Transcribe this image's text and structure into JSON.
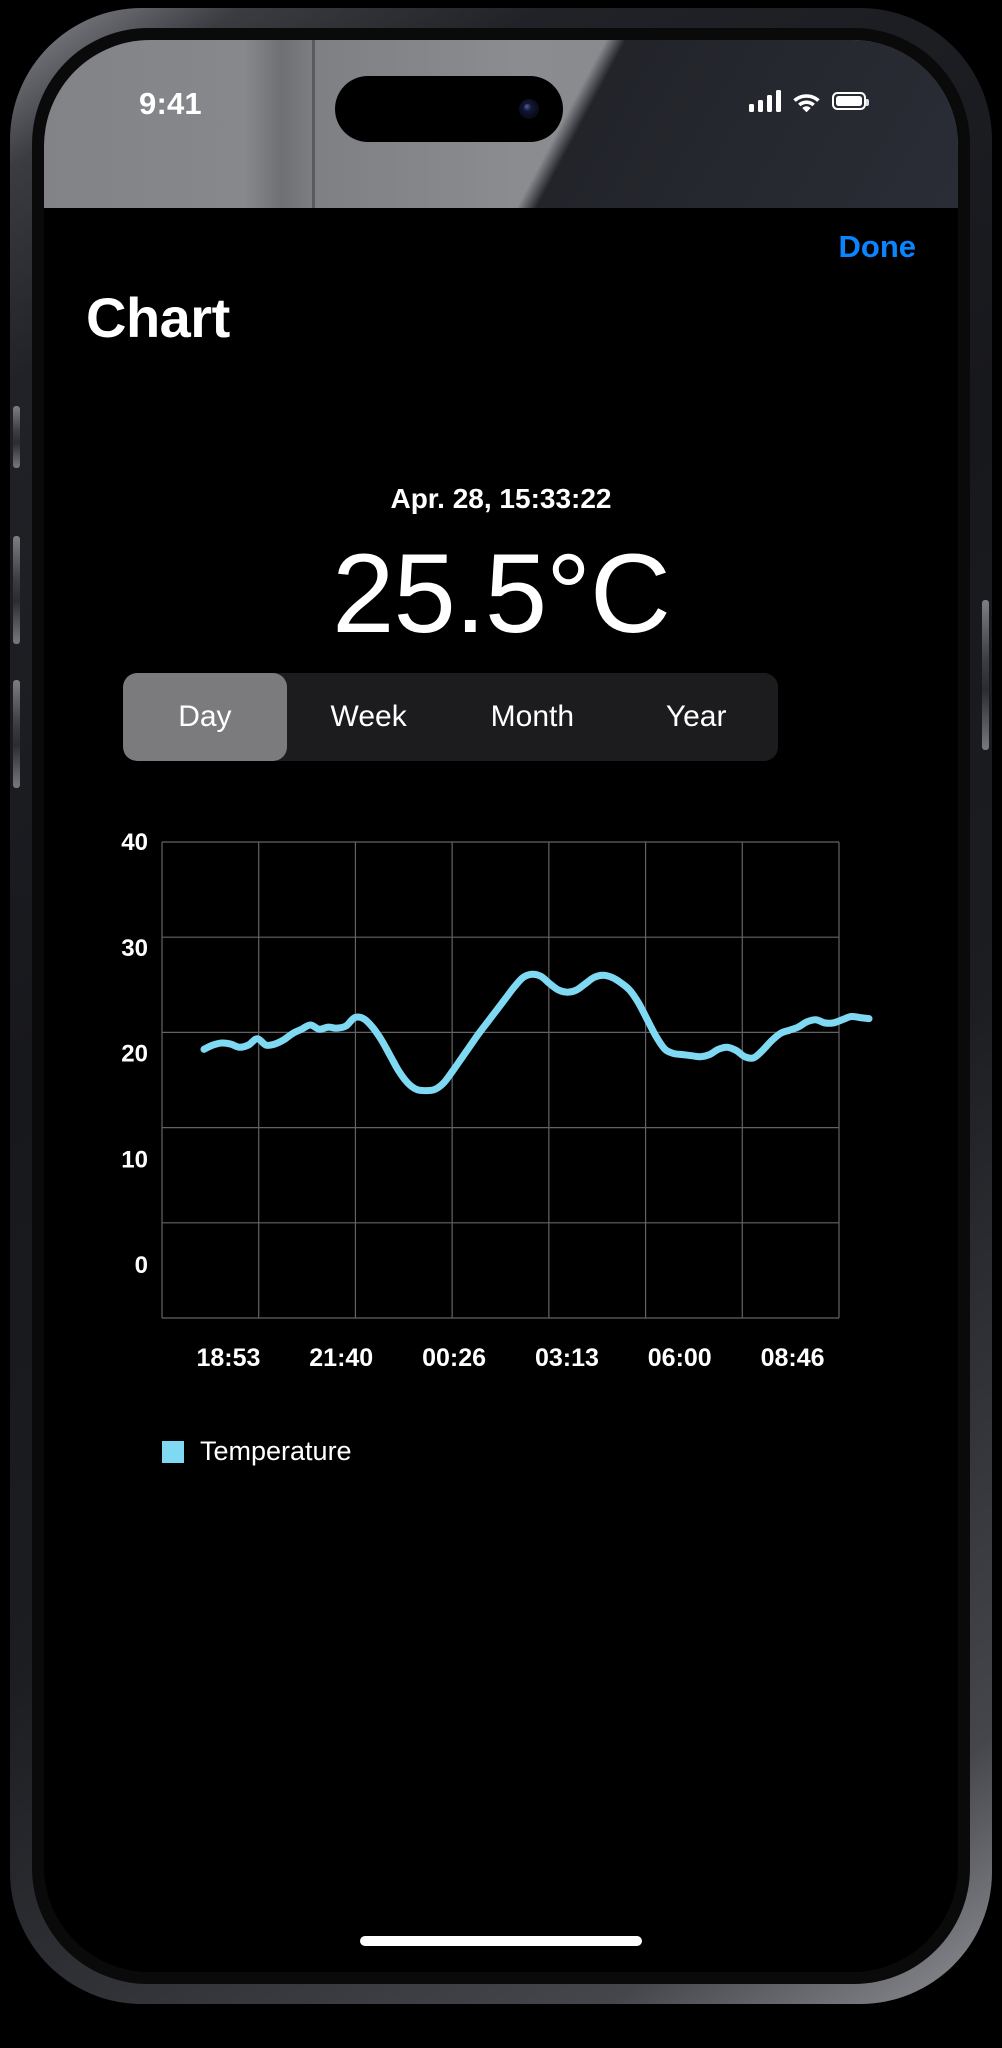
{
  "status_bar": {
    "time": "9:41",
    "signal_icon": "cellular-signal-icon",
    "signal_bars_filled": 4,
    "wifi_icon": "wifi-icon",
    "battery_icon": "battery-full-icon",
    "battery_level_percent": 100
  },
  "nav": {
    "done_label": "Done",
    "title": "Chart"
  },
  "reading": {
    "timestamp": "Apr. 28, 15:33:22",
    "value": "25.5°C"
  },
  "segments": [
    {
      "label": "Day",
      "selected": true
    },
    {
      "label": "Week",
      "selected": false
    },
    {
      "label": "Month",
      "selected": false
    },
    {
      "label": "Year",
      "selected": false
    }
  ],
  "colors": {
    "accent_blue": "#0a84ff",
    "series_line": "#7fd9f2",
    "selected_segment": "#7b7b7e",
    "segment_track": "#1c1c1e",
    "grid": "#636366",
    "background": "#000000"
  },
  "chart_data": {
    "type": "line",
    "title": "",
    "xlabel": "",
    "ylabel": "",
    "ylim": [
      -5,
      40
    ],
    "yticks": [
      40,
      30,
      20,
      10,
      0
    ],
    "ytick_labels": [
      "40",
      "30",
      "20",
      "10",
      "0"
    ],
    "xtick_labels": [
      "18:53",
      "21:40",
      "00:26",
      "03:13",
      "06:00",
      "08:46"
    ],
    "grid": true,
    "legend_position": "bottom-left",
    "legend": [
      "Temperature"
    ],
    "series": [
      {
        "name": "Temperature",
        "color": "#7fd9f2",
        "unit": "°C",
        "values": [
          20.4,
          20.8,
          21.0,
          20.9,
          20.6,
          20.8,
          21.4,
          20.8,
          20.9,
          21.3,
          21.9,
          22.3,
          22.7,
          22.3,
          22.5,
          22.4,
          22.6,
          23.4,
          23.3,
          22.5,
          21.3,
          19.8,
          18.3,
          17.2,
          16.6,
          16.5,
          16.6,
          17.2,
          18.3,
          19.5,
          20.7,
          21.9,
          23.0,
          24.1,
          25.2,
          26.3,
          27.2,
          27.5,
          27.3,
          26.6,
          26.0,
          25.8,
          26.0,
          26.6,
          27.2,
          27.4,
          27.2,
          26.7,
          26.0,
          24.8,
          23.2,
          21.6,
          20.4,
          20.0,
          19.9,
          19.8,
          19.7,
          19.9,
          20.4,
          20.6,
          20.3,
          19.7,
          19.6,
          20.3,
          21.2,
          21.9,
          22.2,
          22.5,
          23.0,
          23.2,
          22.9,
          22.9,
          23.2,
          23.5,
          23.4,
          23.3
        ]
      }
    ],
    "x_min_label": "18:53",
    "x_max_label": "08:46",
    "y_min_visible": 16.5,
    "y_max_visible": 27.5
  }
}
